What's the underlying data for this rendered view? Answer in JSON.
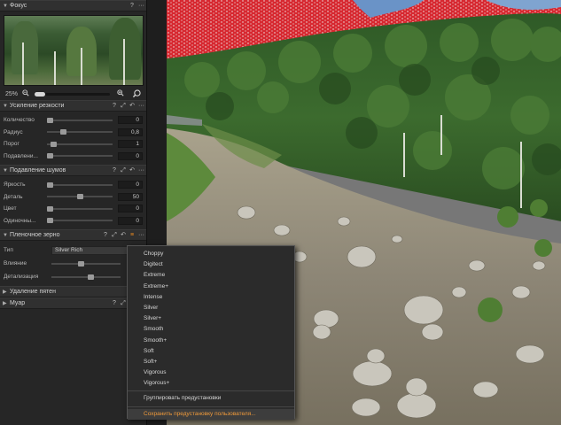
{
  "panel": {
    "focus": {
      "title": "Фокус",
      "help_icon": "question-icon",
      "menu_icon": "more-icon",
      "zoom_value": "25%",
      "zoom_out_icon": "zoom-out-icon",
      "zoom_in_icon": "zoom-in-icon",
      "loupe_icon": "loupe-icon"
    },
    "sharpening": {
      "title": "Усиление резкости",
      "rows": [
        {
          "label": "Количество",
          "value": "0"
        },
        {
          "label": "Радиус",
          "value": "0,8"
        },
        {
          "label": "Порог",
          "value": "1"
        },
        {
          "label": "Подавлени...",
          "value": "0"
        }
      ]
    },
    "noise": {
      "title": "Подавление шумов",
      "rows": [
        {
          "label": "Яркость",
          "value": "0"
        },
        {
          "label": "Деталь",
          "value": "50"
        },
        {
          "label": "Цвет",
          "value": "0"
        },
        {
          "label": "Одиночны...",
          "value": "0"
        }
      ]
    },
    "grain": {
      "title": "Пленочное зерно",
      "type_label": "Тип",
      "type_value": "Silver Rich",
      "impact_label": "Влияние",
      "granularity_label": "Детализация",
      "impact_level": 0.42,
      "granularity_level": 0.58
    },
    "spot_removal": {
      "title": "Удаление пятен"
    },
    "moire": {
      "title": "Муар"
    }
  },
  "grain_menu": {
    "items": [
      "Choppy",
      "Digitect",
      "Extreme",
      "Extreme+",
      "Intense",
      "Silver",
      "Silver+",
      "Smooth",
      "Smooth+",
      "Soft",
      "Soft+",
      "Vigorous",
      "Vigorous+"
    ],
    "group_label": "Группировать предустановки",
    "save_label": "Сохранить предустановку пользователя..."
  },
  "colors": {
    "accent": "#f08b1e",
    "panel_bg": "#262626",
    "header_bg": "#303030",
    "clipping_overlay": "#e0222a"
  }
}
